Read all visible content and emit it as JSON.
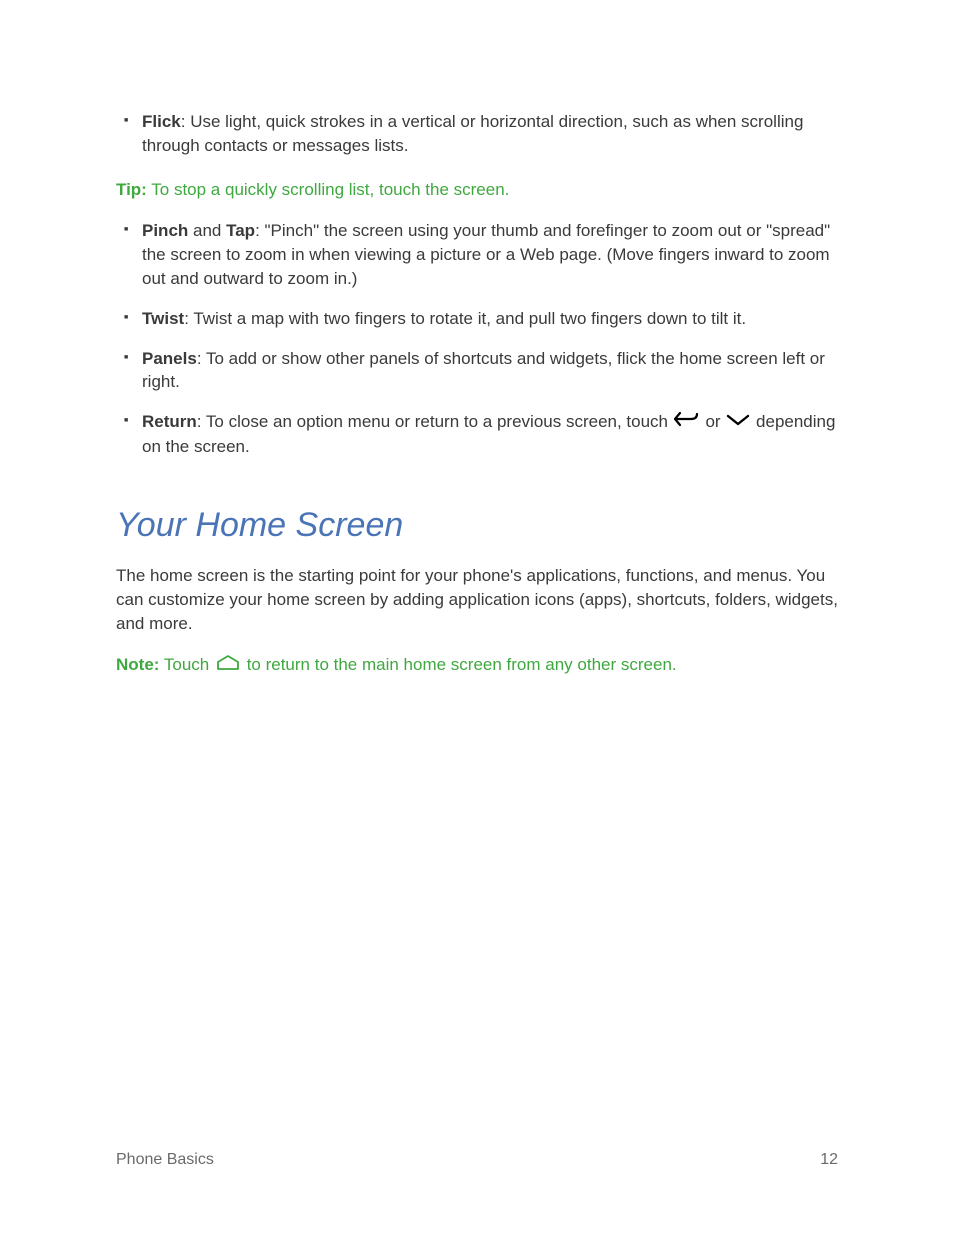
{
  "bullets_top": [
    {
      "term": "Flick",
      "text": ": Use light, quick strokes in a vertical or horizontal direction, such as when scrolling through contacts or messages lists."
    }
  ],
  "tip": {
    "label": "Tip:",
    "text": "  To stop a quickly scrolling list, touch the screen."
  },
  "bullets_mid": [
    {
      "term": "Pinch",
      "connector": " and ",
      "term2": "Tap",
      "text": ": \"Pinch\" the screen using your thumb and forefinger to zoom out or \"spread\" the screen to zoom in when viewing a picture or a Web page. (Move fingers inward to zoom out and outward to zoom in.)"
    },
    {
      "term": "Twist",
      "text": ": Twist a map with two fingers to rotate it, and pull two fingers down to tilt it."
    },
    {
      "term": "Panels",
      "text": ":  To add or show other panels of shortcuts and widgets, flick the home screen left or right."
    },
    {
      "term": "Return",
      "text_before": ": To close an option menu or return to a previous screen, touch ",
      "text_mid": " or ",
      "text_after": " depending on the screen."
    }
  ],
  "section_heading": "Your Home Screen",
  "section_para": "The home screen is the starting point for your phone's applications, functions, and menus. You can customize your home screen by adding application icons (apps), shortcuts, folders, widgets, and more.",
  "note": {
    "label": "Note:",
    "before": " Touch ",
    "after": " to return to the main home screen from any other screen."
  },
  "footer": {
    "left": "Phone Basics",
    "right": "12"
  }
}
